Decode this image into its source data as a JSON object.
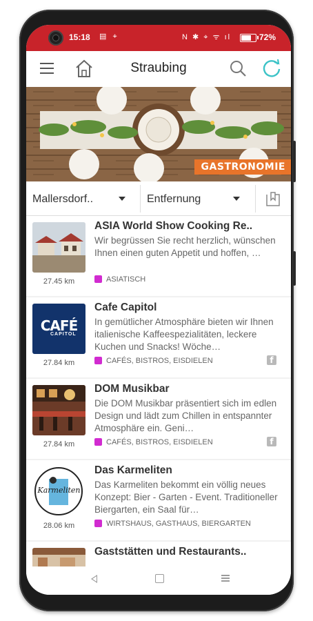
{
  "status": {
    "time": "15:18",
    "left_icons": "▤ ⌖",
    "right_icons": "N ✱ ⌖ ᯤ ıl",
    "battery_level": 0.72,
    "battery_text": "72%"
  },
  "appbar": {
    "title": "Straubing",
    "icons": [
      "menu-icon",
      "home-icon",
      "search-icon",
      "refresh-icon"
    ],
    "accent": "#3cc3c7"
  },
  "banner": {
    "label": "GASTRONOMIE",
    "label_color": "#e8742a"
  },
  "filters": {
    "location": "Mallersdorf..",
    "sort": "Entfernung"
  },
  "items": [
    {
      "title": "ASIA World Show Cooking Re..",
      "description": "Wir begrüssen Sie recht herzlich, wünschen Ihnen einen guten Appetit und hoffen, …",
      "distance": "27.45 km",
      "category": "ASIATISCH",
      "facebook": false
    },
    {
      "title": "Cafe Capitol",
      "description": "In gemütlicher Atmosphäre bieten wir Ihnen italienische Kaffeespezialitäten, leckere Kuchen und Snacks!  Wöche…",
      "distance": "27.84 km",
      "category": "CAFÉS, BISTROS, EISDIELEN",
      "facebook": true,
      "logo_text": "CAFÉ",
      "logo_sub": "CAPITOL"
    },
    {
      "title": "DOM Musikbar",
      "description": "Die DOM Musikbar präsentiert sich im edlen Design und lädt zum Chillen in entspannter Atmosphäre ein. Geni…",
      "distance": "27.84 km",
      "category": "CAFÉS, BISTROS, EISDIELEN",
      "facebook": true
    },
    {
      "title": "Das Karmeliten",
      "description": "Das Karmeliten bekommt ein völlig neues Konzept: Bier - Garten - Event. Traditioneller Biergarten, ein Saal für…",
      "distance": "28.06 km",
      "category": "WIRTSHAUS, GASTHAUS, BIERGARTEN",
      "facebook": false,
      "logo_text": "Karmeliten"
    },
    {
      "title": "Gaststätten und Restaurants..",
      "description": "",
      "distance": "",
      "category": "",
      "facebook": false
    }
  ],
  "colors": {
    "statusbar": "#c8232a",
    "category": "#d12bd0"
  },
  "navbar": {
    "icons": [
      "back-icon",
      "home-square-icon",
      "recents-icon"
    ]
  }
}
